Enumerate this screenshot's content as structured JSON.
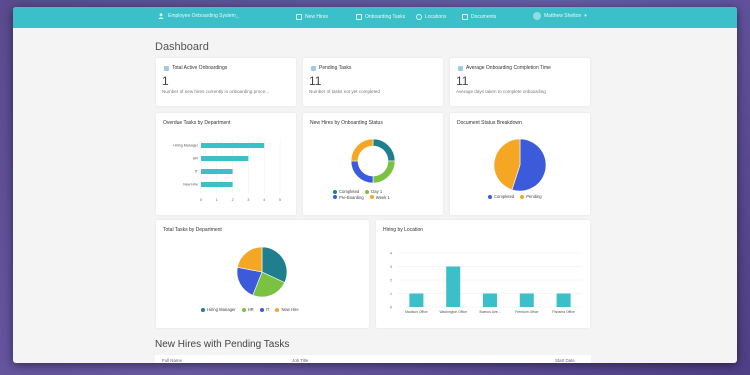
{
  "topbar": {
    "app_title": "Employee Onboarding System_",
    "nav": [
      "New Hires",
      "Onboarding Tasks",
      "Locations",
      "Documents"
    ],
    "user": "Matthew Shelton"
  },
  "page_title": "Dashboard",
  "kpis": [
    {
      "title": "Total Active Onboardings",
      "value": "1",
      "desc": "Number of new hires currently in onboarding proce..."
    },
    {
      "title": "Pending Tasks",
      "value": "11",
      "desc": "Number of tasks not yet completed"
    },
    {
      "title": "Average Onboarding Completion Time",
      "value": "11",
      "desc": "Average days taken to complete onboarding"
    }
  ],
  "chart_data": [
    {
      "type": "bar",
      "orientation": "horizontal",
      "title": "Overdue Tasks by Department",
      "categories": [
        "Hiring Manager",
        "HR",
        "IT",
        "New Hire"
      ],
      "values": [
        4,
        3,
        2,
        2
      ],
      "xlim": [
        0,
        5
      ],
      "xticks": [
        "0",
        "1",
        "2",
        "3",
        "4",
        "5"
      ],
      "color": "#3bbfc8"
    },
    {
      "type": "pie",
      "variant": "donut",
      "title": "New Hires by Onboarding Status",
      "categories": [
        "Completed",
        "Day 1",
        "Pre-Boarding",
        "Week 1"
      ],
      "values": [
        1,
        1,
        1,
        1
      ],
      "colors": [
        "#1f7f8c",
        "#7cc242",
        "#3b5bdb",
        "#f5a623"
      ]
    },
    {
      "type": "pie",
      "title": "Document Status Breakdown",
      "categories": [
        "Completed",
        "Pending"
      ],
      "values": [
        55,
        45
      ],
      "colors": [
        "#3b5bdb",
        "#f5a623"
      ]
    },
    {
      "type": "pie",
      "title": "Total Tasks by Department",
      "categories": [
        "Hiring Manager",
        "HR",
        "IT",
        "New Hire"
      ],
      "values": [
        32,
        24,
        22,
        22
      ],
      "colors": [
        "#1f7f8c",
        "#7cc242",
        "#3b5bdb",
        "#f5a623"
      ]
    },
    {
      "type": "bar",
      "title": "Hiring by Location",
      "categories": [
        "Madison Office",
        "Washington Office",
        "Buenos Aire...",
        "Freedom Office",
        "Panama Office"
      ],
      "values": [
        1,
        3,
        1,
        1,
        1
      ],
      "ylim": [
        0,
        4
      ],
      "yticks": [
        "0",
        "1",
        "2",
        "3",
        "4"
      ],
      "color": "#3bbfc8"
    }
  ],
  "section_title": "New Hires with Pending Tasks",
  "table": {
    "columns": [
      "Full Name",
      "Job Title",
      "Start Date"
    ]
  }
}
